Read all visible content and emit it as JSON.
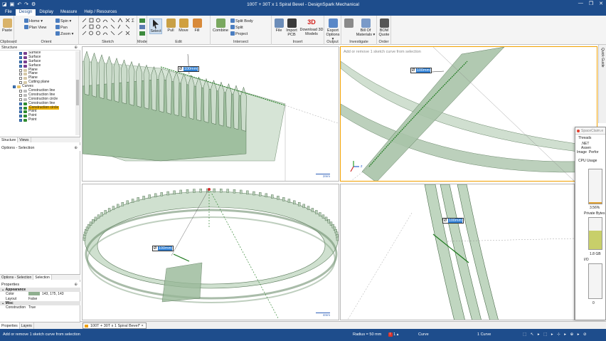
{
  "window": {
    "title": "100T + 30T x 1 Spiral Bevel - DesignSpark Mechanical",
    "qat_icons": [
      "app-icon",
      "save-icon",
      "undo-icon",
      "redo-icon",
      "options-icon"
    ],
    "controls": [
      "—",
      "❐",
      "✕"
    ]
  },
  "menu": {
    "tabs": [
      "File",
      "Design",
      "Display",
      "Measure",
      "Help / Resources"
    ],
    "active": "Design"
  },
  "ribbon": {
    "clipboard": {
      "label": "Clipboard",
      "paste": "Paste"
    },
    "orient": {
      "label": "Orient",
      "items": [
        "Home ▾",
        "Plan View",
        "Spin ▾",
        "Pan",
        "Zoom ▾"
      ]
    },
    "sketch": {
      "label": "Sketch"
    },
    "mode": {
      "label": "Mode"
    },
    "edit": {
      "label": "Edit",
      "buttons": [
        "Select",
        "Pull",
        "Move",
        "Fill"
      ]
    },
    "intersect": {
      "label": "Intersect",
      "combine": "Combine",
      "items": [
        "Split Body",
        "Split",
        "Project"
      ]
    },
    "insert": {
      "label": "Insert",
      "buttons": [
        "File",
        "Import PCB",
        "Download 3D Models"
      ],
      "logo": "3D"
    },
    "output": {
      "label": "Output",
      "button": "Export Options ▾"
    },
    "investigate": {
      "label": "Investigate",
      "button": "Bill Of Materials ▾"
    },
    "order": {
      "label": "Order",
      "button": "BOM Quote"
    }
  },
  "structure": {
    "title": "Structure",
    "items": [
      {
        "label": "Surface",
        "type": "surface",
        "checked": true,
        "indent": 3
      },
      {
        "label": "Surface",
        "type": "surface",
        "checked": true,
        "indent": 3
      },
      {
        "label": "Surface",
        "type": "surface",
        "checked": true,
        "indent": 3
      },
      {
        "label": "Surface",
        "type": "surface",
        "checked": true,
        "indent": 3
      },
      {
        "label": "Plane",
        "type": "plane",
        "checked": false,
        "indent": 3
      },
      {
        "label": "Plane",
        "type": "plane",
        "checked": false,
        "indent": 3
      },
      {
        "label": "Plane",
        "type": "plane",
        "checked": false,
        "indent": 3
      },
      {
        "label": "Cutting plane",
        "type": "plane",
        "checked": false,
        "indent": 3
      },
      {
        "label": "Curves",
        "type": "folder",
        "checked": true,
        "indent": 2
      },
      {
        "label": "Construction line",
        "type": "line",
        "checked": false,
        "indent": 3
      },
      {
        "label": "Construction line",
        "type": "line",
        "checked": false,
        "indent": 3
      },
      {
        "label": "Construction circle",
        "type": "line",
        "checked": false,
        "indent": 3
      },
      {
        "label": "Construction line",
        "type": "curve",
        "checked": true,
        "indent": 3
      },
      {
        "label": "Construction circle",
        "type": "curve",
        "checked": true,
        "indent": 3,
        "selected": true
      },
      {
        "label": "Point",
        "type": "curve",
        "checked": true,
        "indent": 3
      },
      {
        "label": "Point",
        "type": "curve",
        "checked": true,
        "indent": 3
      },
      {
        "label": "Point",
        "type": "curve",
        "checked": true,
        "indent": 3
      }
    ],
    "tabs": [
      "Structure",
      "Views"
    ]
  },
  "options": {
    "title": "Options - Selection",
    "tabs": [
      "Options - Selection",
      "Selection"
    ]
  },
  "properties": {
    "title": "Properties",
    "rows": [
      {
        "group": true,
        "key": "Appearance"
      },
      {
        "key": "Color",
        "value": "143, 175, 143",
        "swatch": "#8faf8f"
      },
      {
        "key": "Layout",
        "value": "False"
      },
      {
        "group": true,
        "key": "Misc"
      },
      {
        "key": "Construction",
        "value": "True"
      }
    ],
    "tabs": [
      "Properties",
      "Layers"
    ]
  },
  "viewports": {
    "tl": {
      "dim_symbol": "Ø",
      "dim_value": "100mm",
      "scale": "2mm"
    },
    "tr": {
      "hint": "Add or remove 1 sketch curve from selection",
      "dim_symbol": "Ø",
      "dim_value": "100mm",
      "axis_z": "z"
    },
    "bl": {
      "dim_symbol": "Ø",
      "dim_value": "100mm",
      "scale": "4mm"
    },
    "br": {
      "dim_symbol": "Ø",
      "dim_value": "100mm"
    }
  },
  "quick_side": "Quick Guide",
  "diag_window": {
    "title": "SpaceClaim.e",
    "threads": "Threads",
    ".net": ".NET Assen",
    "image": "Image",
    "perf": "Perfor",
    "cpu_label": "CPU Usage",
    "cpu_value": "3.56%",
    "cpu_level": 0.04,
    "mem_label": "Private Bytes",
    "mem_value": "1.8 GB",
    "mem_level": 0.6,
    "io_label": "I/O",
    "io_value": "0"
  },
  "doc_tab": "100T + 30T x 1 Spiral Bevel* ×",
  "status": {
    "message": "Add or remove 1 sketch curve from selection",
    "radius": "Radius = 50 mm",
    "errors": "1 ▴",
    "type": "Curve",
    "count": "1 Curve"
  },
  "colors": {
    "brand": "#1e4d8c",
    "model_fill": "#b6cdb6",
    "model_edge": "#5b7a5b",
    "sketch": "#1e7a1e",
    "dim_value_bg": "#2d7fd6"
  }
}
